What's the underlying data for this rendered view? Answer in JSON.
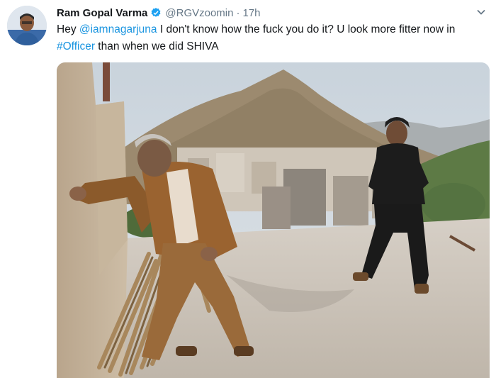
{
  "tweet": {
    "author_name": "Ram Gopal Varma",
    "handle": "@RGVzoomin",
    "separator": "·",
    "time": "17h",
    "text": {
      "prefix": "Hey ",
      "mention": "@iamnagarjuna",
      "middle": " I don't know how the fuck you do it? U look more fitter now in ",
      "hashtag": "#Officer",
      "suffix": " than when we did SHIVA"
    }
  },
  "icons": {
    "verified": "verified-badge-icon",
    "caret": "chevron-down-icon"
  },
  "colors": {
    "link": "#1b95e0",
    "verified": "#1da1f2",
    "secondary_text": "#657786",
    "text": "#14171a"
  }
}
